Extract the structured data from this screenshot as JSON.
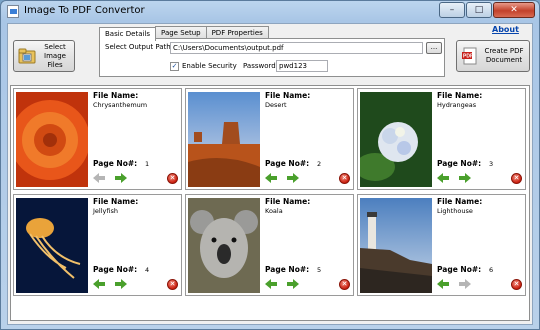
{
  "window": {
    "title": "Image To PDF Convertor",
    "controls": {
      "minimize": "–",
      "maximize": "□",
      "close": "✕"
    }
  },
  "toolbar": {
    "select_label": "Select Image\nFiles",
    "create_label": "Create PDF\nDocument",
    "about_label": "About"
  },
  "tabs": [
    {
      "label": "Basic Details",
      "active": true
    },
    {
      "label": "Page Setup",
      "active": false
    },
    {
      "label": "PDF Properties",
      "active": false
    }
  ],
  "basic": {
    "output_label": "Select Output Path",
    "output_value": "C:\\Users\\Documents\\output.pdf",
    "browse_label": "...",
    "security_checked": true,
    "security_label": "Enable Security",
    "password_label": "Password",
    "password_value": "pwd123"
  },
  "card_labels": {
    "file_name": "File Name:",
    "page_no": "Page No#:"
  },
  "images": [
    {
      "name": "Chrysanthemum",
      "page": "1",
      "up_enabled": false,
      "down_enabled": true
    },
    {
      "name": "Desert",
      "page": "2",
      "up_enabled": true,
      "down_enabled": true
    },
    {
      "name": "Hydrangeas",
      "page": "3",
      "up_enabled": true,
      "down_enabled": true
    },
    {
      "name": "Jellyfish",
      "page": "4",
      "up_enabled": true,
      "down_enabled": true
    },
    {
      "name": "Koala",
      "page": "5",
      "up_enabled": true,
      "down_enabled": true
    },
    {
      "name": "Lighthouse",
      "page": "6",
      "up_enabled": true,
      "down_enabled": false
    }
  ],
  "colors": {
    "arrow_enabled": "#4aa02c",
    "arrow_disabled": "#b5b5b5",
    "delete": "#cc2010"
  }
}
